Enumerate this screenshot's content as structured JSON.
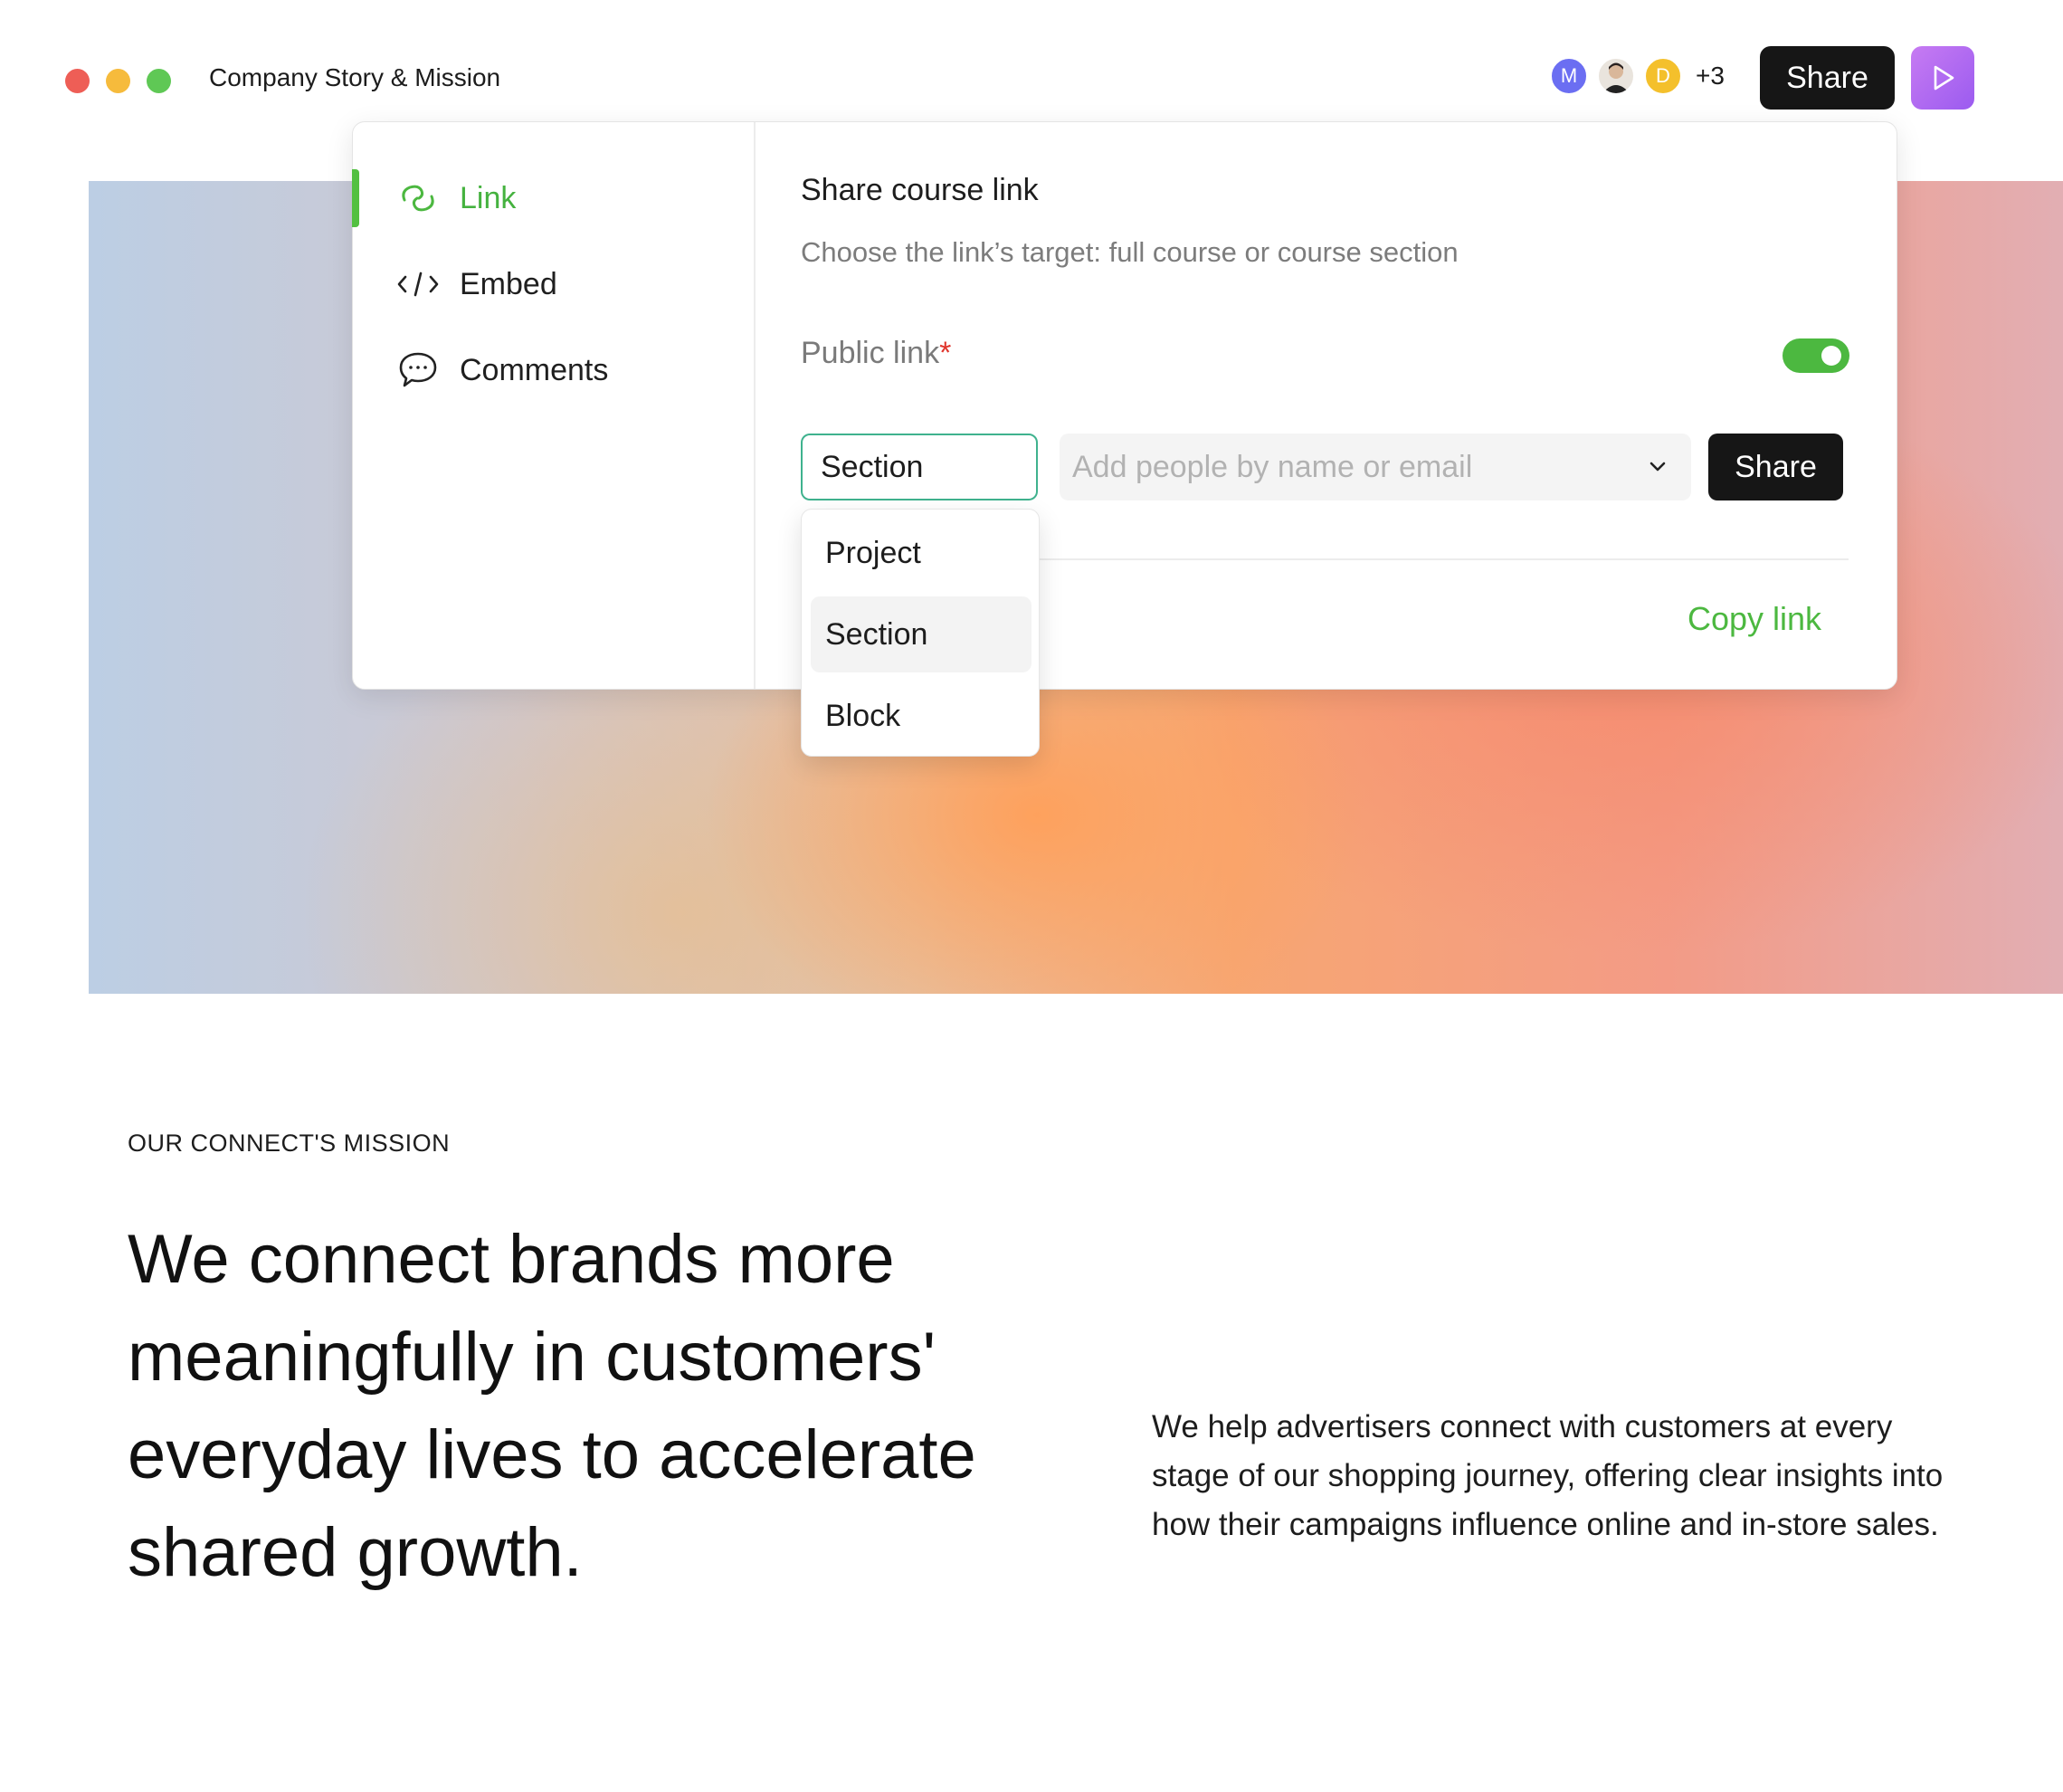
{
  "window": {
    "title": "Company Story & Mission"
  },
  "header": {
    "avatars": [
      {
        "initial": "M",
        "color": "#6b6ef2"
      },
      {
        "initial": "",
        "kind": "photo"
      },
      {
        "initial": "D",
        "color": "#f4c02c"
      }
    ],
    "avatar_overflow": "+3",
    "share_label": "Share",
    "play_icon": "play-icon"
  },
  "share_dialog": {
    "sidebar": [
      {
        "label": "Link",
        "icon": "link-icon",
        "active": true
      },
      {
        "label": "Embed",
        "icon": "code-icon",
        "active": false
      },
      {
        "label": "Comments",
        "icon": "comment-icon",
        "active": false
      }
    ],
    "title": "Share course link",
    "subtitle": "Choose the link’s target: full course or course section",
    "public_link_label": "Public link",
    "required_mark": "*",
    "public_link_enabled": true,
    "target_select": {
      "value": "Section",
      "options": [
        "Project",
        "Section",
        "Block"
      ],
      "selected_index": 1
    },
    "people_input_placeholder": "Add people by name or email",
    "share_label": "Share",
    "copy_link_label": "Copy link",
    "accent_color": "#4cb840"
  },
  "mission": {
    "eyebrow": "OUR CONNECT'S MISSION",
    "headline": "We connect brands more meaningfully in customers' everyday lives to accelerate shared growth.",
    "body": "We help advertisers connect with customers at every stage of our shopping journey, offering clear insights into how their campaigns influence online and in-store sales."
  }
}
